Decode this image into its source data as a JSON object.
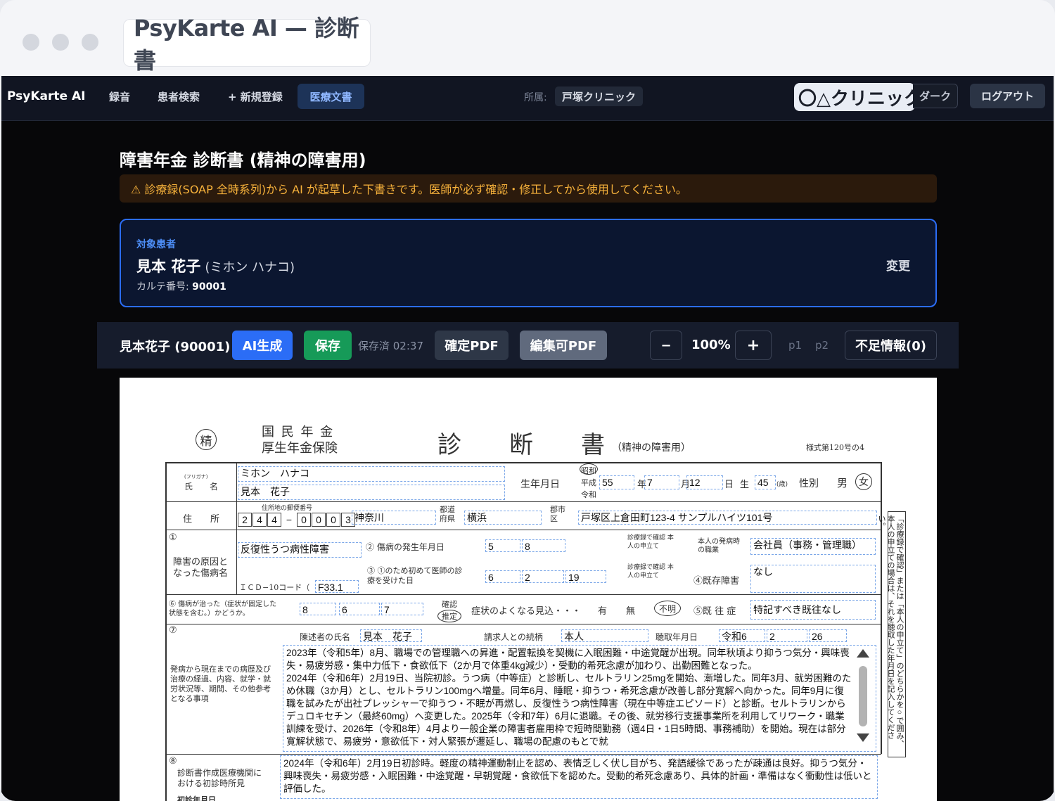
{
  "window": {
    "tab_title": "PsyKarte AI — 診断書"
  },
  "nav": {
    "brand": "PsyKarte AI",
    "links": [
      "録音",
      "患者検索",
      "+ 新規登録"
    ],
    "active": "医療文書",
    "affiliation_label": "所属:",
    "affiliation_value": "戸塚クリニック",
    "clinic_overlay": "〇△クリニック",
    "dark": "ダーク",
    "logout": "ログアウト"
  },
  "page": {
    "title": "障害年金 診断書 (精神の障害用)",
    "warning": "⚠ 診療録(SOAP 全時系列)から AI が起草した下書きです。医師が必ず確認・修正してから使用してください。"
  },
  "patient_card": {
    "label": "対象患者",
    "name": "見本 花子",
    "kana": "(ミホン ハナコ)",
    "karte_label": "カルテ番号:",
    "karte_no": "90001",
    "change": "変更"
  },
  "toolbar": {
    "patient": "見本花子 (90001)",
    "ai_generate": "AI生成",
    "save": "保存",
    "saved_status": "保存済 02:37",
    "final_pdf": "確定PDF",
    "edit_pdf": "編集可PDF",
    "zoom_out": "−",
    "zoom": "100%",
    "zoom_in": "+",
    "page1": "p1",
    "page2": "p2",
    "missing": "不足情報(0)",
    "colors": {
      "ai": "#2b6df6",
      "save": "#169a58",
      "final": "#2e3747",
      "edit": "#606a7d"
    }
  },
  "form": {
    "seal": "精",
    "insurer1": "国 民 年 金",
    "insurer2": "厚生年金保険",
    "title": "診　　断　　書",
    "subtitle": "（精神の障害用）",
    "form_no": "様式第120号の4",
    "furigana_label": "(フリガナ)",
    "name_label": "氏　　名",
    "furigana": "ミホン　ハナコ",
    "name": "見本　花子",
    "dob_label": "生年月日",
    "era_showa": "昭和",
    "era_heisei": "平成",
    "era_reiwa": "令和",
    "dob_year": "55",
    "dob_month": "7",
    "dob_day": "12",
    "unit_year": "年",
    "unit_month": "月",
    "unit_day": "日",
    "unit_birth": "生",
    "age": "45",
    "age_unit": "(歳)",
    "sex_label": "性別",
    "sex_male": "男",
    "sex_female": "女",
    "address_label": "住　　所",
    "postal_label": "住所地の郵便番号",
    "postal": [
      "2",
      "4",
      "4",
      "−",
      "0",
      "0",
      "0",
      "3"
    ],
    "prefecture": "神奈川",
    "pref_suffix": "都道府県",
    "city": "横浜",
    "city_suffix": "郡市区",
    "street": "戸塚区上倉田町123-4 サンプルハイツ101号",
    "q1_label": "障害の原因となった傷病名",
    "q1_no": "①",
    "diagnosis": "反復性うつ病性障害",
    "icd_label": "ＩＣＤ−10コード（",
    "icd": "F33.1",
    "q2_label": "② 傷病の発生年月日",
    "q2_year": "5",
    "q2_month": "8",
    "q3_label": "③ ①のため初めて医師の診療を受けた日",
    "q3_year": "6",
    "q3_month": "2",
    "q3_day": "19",
    "src_note": "診療録で確認 本人の申立て",
    "job_label": "本人の発病時の職業",
    "job": "会社員（事務・管理職）",
    "q4_label": "④既存障害",
    "q4": "なし",
    "q5_label": "⑤既 往 症",
    "q5": "特記すべき既往なし",
    "q6_label": "⑥ 傷病が治った（症状が固定した状態を含む。）かどうか。",
    "q6_year": "8",
    "q6_month": "6",
    "q6_day": "7",
    "q6_confirm": "確認",
    "q6_estimate": "推定",
    "outlook_label": "症状のよくなる見込・・・",
    "outlook_yes": "有",
    "outlook_no": "無",
    "outlook_unknown": "不明",
    "q7_no": "⑦",
    "q7_label": "発病から現在までの病歴及び治療の経過、内容、就学・就労状況等、期間、その他参考となる事項",
    "narrator_label": "陳述者の氏名",
    "narrator": "見本　花子",
    "relation_label": "請求人との続柄",
    "relation": "本人",
    "listen_label": "聴取年月日",
    "listen_era": "令和6",
    "listen_month": "2",
    "listen_day": "26",
    "history": "2023年（令和5年）8月、職場での管理職への昇進・配置転換を契機に入眠困難・中途覚醒が出現。同年秋頃より抑うつ気分・興味喪失・易疲労感・集中力低下・食欲低下（2か月で体重4kg減少）・受動的希死念慮が加わり、出勤困難となった。\n2024年（令和6年）2月19日、当院初診。うつ病（中等症）と診断し、セルトラリン25mgを開始、漸増した。同年3月、就労困難のため休職（3か月）とし、セルトラリン100mgへ増量。同年6月、睡眠・抑うつ・希死念慮が改善し部分寛解へ向かった。同年9月に復職を試みたが出社プレッシャーで抑うつ・不眠が再燃し、反復性うつ病性障害（現在中等症エピソード）と診断。セルトラリンからデュロキセチン（最終60mg）へ変更した。2025年（令和7年）6月に退職。その後、就労移行支援事業所を利用してリワーク・職業訓練を受け、2026年（令和8年）4月より一般企業の障害者雇用枠で短時間勤務（週4日・1日5時間、事務補助）を開始。現在は部分寛解状態で、易疲労・意欲低下・対人緊張が遷延し、職場の配慮のもとで就",
    "q8_no": "⑧",
    "q8_label": "診断書作成医療機関における初診時所見",
    "q8_sub": "初診年月日",
    "initial_findings": "2024年（令和6年）2月19日初診時。軽度の精神運動制止を認め、表情乏しく伏し目がち、発語緩徐であったが疎通は良好。抑うつ気分・興味喪失・易疲労感・入眠困難・中途覚醒・早朝覚醒・食欲低下を認めた。受動的希死念慮あり、具体的計画・準備はなく衝動性は低いと評価した。",
    "side_note": "「診療録で確認」または「本人の申立て」のどちらかを○で囲み、本人の申立ての場合は、それを聴取した年月日を記入してください。"
  }
}
